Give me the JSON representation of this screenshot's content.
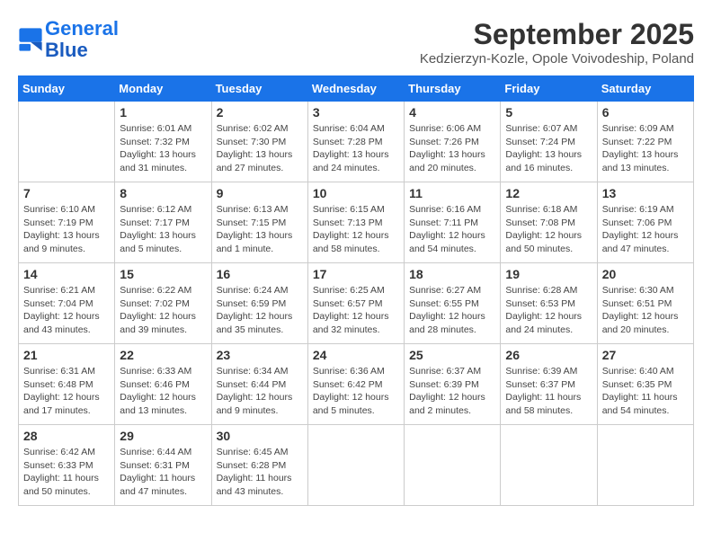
{
  "header": {
    "logo_line1": "General",
    "logo_line2": "Blue",
    "month": "September 2025",
    "location": "Kedzierzyn-Kozle, Opole Voivodeship, Poland"
  },
  "days_of_week": [
    "Sunday",
    "Monday",
    "Tuesday",
    "Wednesday",
    "Thursday",
    "Friday",
    "Saturday"
  ],
  "weeks": [
    [
      {
        "day": "",
        "content": ""
      },
      {
        "day": "1",
        "content": "Sunrise: 6:01 AM\nSunset: 7:32 PM\nDaylight: 13 hours\nand 31 minutes."
      },
      {
        "day": "2",
        "content": "Sunrise: 6:02 AM\nSunset: 7:30 PM\nDaylight: 13 hours\nand 27 minutes."
      },
      {
        "day": "3",
        "content": "Sunrise: 6:04 AM\nSunset: 7:28 PM\nDaylight: 13 hours\nand 24 minutes."
      },
      {
        "day": "4",
        "content": "Sunrise: 6:06 AM\nSunset: 7:26 PM\nDaylight: 13 hours\nand 20 minutes."
      },
      {
        "day": "5",
        "content": "Sunrise: 6:07 AM\nSunset: 7:24 PM\nDaylight: 13 hours\nand 16 minutes."
      },
      {
        "day": "6",
        "content": "Sunrise: 6:09 AM\nSunset: 7:22 PM\nDaylight: 13 hours\nand 13 minutes."
      }
    ],
    [
      {
        "day": "7",
        "content": "Sunrise: 6:10 AM\nSunset: 7:19 PM\nDaylight: 13 hours\nand 9 minutes."
      },
      {
        "day": "8",
        "content": "Sunrise: 6:12 AM\nSunset: 7:17 PM\nDaylight: 13 hours\nand 5 minutes."
      },
      {
        "day": "9",
        "content": "Sunrise: 6:13 AM\nSunset: 7:15 PM\nDaylight: 13 hours\nand 1 minute."
      },
      {
        "day": "10",
        "content": "Sunrise: 6:15 AM\nSunset: 7:13 PM\nDaylight: 12 hours\nand 58 minutes."
      },
      {
        "day": "11",
        "content": "Sunrise: 6:16 AM\nSunset: 7:11 PM\nDaylight: 12 hours\nand 54 minutes."
      },
      {
        "day": "12",
        "content": "Sunrise: 6:18 AM\nSunset: 7:08 PM\nDaylight: 12 hours\nand 50 minutes."
      },
      {
        "day": "13",
        "content": "Sunrise: 6:19 AM\nSunset: 7:06 PM\nDaylight: 12 hours\nand 47 minutes."
      }
    ],
    [
      {
        "day": "14",
        "content": "Sunrise: 6:21 AM\nSunset: 7:04 PM\nDaylight: 12 hours\nand 43 minutes."
      },
      {
        "day": "15",
        "content": "Sunrise: 6:22 AM\nSunset: 7:02 PM\nDaylight: 12 hours\nand 39 minutes."
      },
      {
        "day": "16",
        "content": "Sunrise: 6:24 AM\nSunset: 6:59 PM\nDaylight: 12 hours\nand 35 minutes."
      },
      {
        "day": "17",
        "content": "Sunrise: 6:25 AM\nSunset: 6:57 PM\nDaylight: 12 hours\nand 32 minutes."
      },
      {
        "day": "18",
        "content": "Sunrise: 6:27 AM\nSunset: 6:55 PM\nDaylight: 12 hours\nand 28 minutes."
      },
      {
        "day": "19",
        "content": "Sunrise: 6:28 AM\nSunset: 6:53 PM\nDaylight: 12 hours\nand 24 minutes."
      },
      {
        "day": "20",
        "content": "Sunrise: 6:30 AM\nSunset: 6:51 PM\nDaylight: 12 hours\nand 20 minutes."
      }
    ],
    [
      {
        "day": "21",
        "content": "Sunrise: 6:31 AM\nSunset: 6:48 PM\nDaylight: 12 hours\nand 17 minutes."
      },
      {
        "day": "22",
        "content": "Sunrise: 6:33 AM\nSunset: 6:46 PM\nDaylight: 12 hours\nand 13 minutes."
      },
      {
        "day": "23",
        "content": "Sunrise: 6:34 AM\nSunset: 6:44 PM\nDaylight: 12 hours\nand 9 minutes."
      },
      {
        "day": "24",
        "content": "Sunrise: 6:36 AM\nSunset: 6:42 PM\nDaylight: 12 hours\nand 5 minutes."
      },
      {
        "day": "25",
        "content": "Sunrise: 6:37 AM\nSunset: 6:39 PM\nDaylight: 12 hours\nand 2 minutes."
      },
      {
        "day": "26",
        "content": "Sunrise: 6:39 AM\nSunset: 6:37 PM\nDaylight: 11 hours\nand 58 minutes."
      },
      {
        "day": "27",
        "content": "Sunrise: 6:40 AM\nSunset: 6:35 PM\nDaylight: 11 hours\nand 54 minutes."
      }
    ],
    [
      {
        "day": "28",
        "content": "Sunrise: 6:42 AM\nSunset: 6:33 PM\nDaylight: 11 hours\nand 50 minutes."
      },
      {
        "day": "29",
        "content": "Sunrise: 6:44 AM\nSunset: 6:31 PM\nDaylight: 11 hours\nand 47 minutes."
      },
      {
        "day": "30",
        "content": "Sunrise: 6:45 AM\nSunset: 6:28 PM\nDaylight: 11 hours\nand 43 minutes."
      },
      {
        "day": "",
        "content": ""
      },
      {
        "day": "",
        "content": ""
      },
      {
        "day": "",
        "content": ""
      },
      {
        "day": "",
        "content": ""
      }
    ]
  ]
}
